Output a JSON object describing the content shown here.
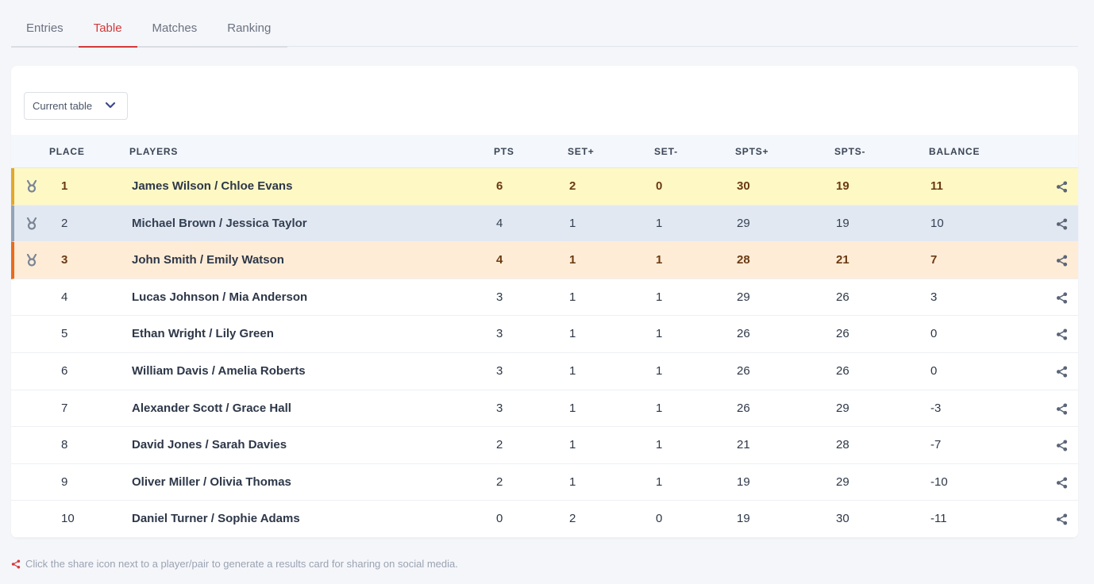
{
  "tabs": [
    {
      "label": "Entries",
      "active": false
    },
    {
      "label": "Table",
      "active": true
    },
    {
      "label": "Matches",
      "active": false
    },
    {
      "label": "Ranking",
      "active": false
    }
  ],
  "filter": {
    "selected": "Current table",
    "icon": "chevron-down-icon"
  },
  "table": {
    "headers": {
      "place": "PLACE",
      "players": "PLAYERS",
      "pts": "PTS",
      "set_plus": "SET+",
      "set_minus": "SET-",
      "spts_plus": "SPTS+",
      "spts_minus": "SPTS-",
      "balance": "BALANCE"
    },
    "rows": [
      {
        "place": "1",
        "players": "James Wilson / Chloe Evans",
        "pts": "6",
        "set_plus": "2",
        "set_minus": "0",
        "spts_plus": "30",
        "spts_minus": "19",
        "balance": "11",
        "medal": "gold"
      },
      {
        "place": "2",
        "players": "Michael Brown / Jessica Taylor",
        "pts": "4",
        "set_plus": "1",
        "set_minus": "1",
        "spts_plus": "29",
        "spts_minus": "19",
        "balance": "10",
        "medal": "silver"
      },
      {
        "place": "3",
        "players": "John Smith / Emily Watson",
        "pts": "4",
        "set_plus": "1",
        "set_minus": "1",
        "spts_plus": "28",
        "spts_minus": "21",
        "balance": "7",
        "medal": "bronze"
      },
      {
        "place": "4",
        "players": "Lucas Johnson / Mia Anderson",
        "pts": "3",
        "set_plus": "1",
        "set_minus": "1",
        "spts_plus": "29",
        "spts_minus": "26",
        "balance": "3",
        "medal": ""
      },
      {
        "place": "5",
        "players": "Ethan Wright / Lily Green",
        "pts": "3",
        "set_plus": "1",
        "set_minus": "1",
        "spts_plus": "26",
        "spts_minus": "26",
        "balance": "0",
        "medal": ""
      },
      {
        "place": "6",
        "players": "William Davis / Amelia Roberts",
        "pts": "3",
        "set_plus": "1",
        "set_minus": "1",
        "spts_plus": "26",
        "spts_minus": "26",
        "balance": "0",
        "medal": ""
      },
      {
        "place": "7",
        "players": "Alexander Scott / Grace Hall",
        "pts": "3",
        "set_plus": "1",
        "set_minus": "1",
        "spts_plus": "26",
        "spts_minus": "29",
        "balance": "-3",
        "medal": ""
      },
      {
        "place": "8",
        "players": "David Jones / Sarah Davies",
        "pts": "2",
        "set_plus": "1",
        "set_minus": "1",
        "spts_plus": "21",
        "spts_minus": "28",
        "balance": "-7",
        "medal": ""
      },
      {
        "place": "9",
        "players": "Oliver Miller / Olivia Thomas",
        "pts": "2",
        "set_plus": "1",
        "set_minus": "1",
        "spts_plus": "19",
        "spts_minus": "29",
        "balance": "-10",
        "medal": ""
      },
      {
        "place": "10",
        "players": "Daniel Turner / Sophie Adams",
        "pts": "0",
        "set_plus": "2",
        "set_minus": "0",
        "spts_plus": "19",
        "spts_minus": "30",
        "balance": "-11",
        "medal": ""
      }
    ]
  },
  "footer": {
    "note": "Click the share icon next to a player/pair to generate a results card for sharing on social media.",
    "icon": "share-icon"
  },
  "colors": {
    "accent": "#d33a3a",
    "gold": "#e0a82e",
    "silver": "#94a3b8",
    "bronze": "#ea6b1c",
    "icon": "#5b6577"
  }
}
